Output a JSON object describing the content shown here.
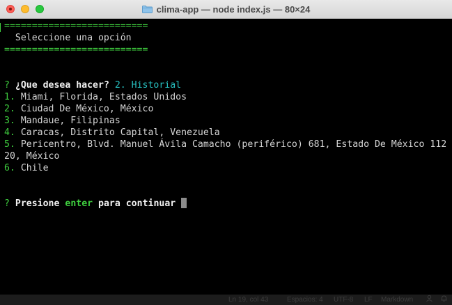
{
  "window": {
    "title": "clima-app — node index.js — 80×24"
  },
  "terminal": {
    "separator": "==========================",
    "header": "  Seleccione una opción",
    "prompt": {
      "mark": "?",
      "question": "¿Que desea hacer?",
      "answer": "2. Historial"
    },
    "history": [
      {
        "num": "1.",
        "text": "Miami, Florida, Estados Unidos"
      },
      {
        "num": "2.",
        "text": "Ciudad De México, México"
      },
      {
        "num": "3.",
        "text": "Mandaue, Filipinas"
      },
      {
        "num": "4.",
        "text": "Caracas, Distrito Capital, Venezuela"
      },
      {
        "num": "5.",
        "text": "Pericentro, Blvd. Manuel Ávila Camacho (periférico) 681, Estado De México 112"
      },
      {
        "num": "6.",
        "text": "Chile"
      }
    ],
    "history_wrap": "20, México",
    "continue": {
      "mark": "?",
      "before": "Presione",
      "key": "enter",
      "after": "para continuar"
    }
  },
  "statusbar": {
    "position": "Ln 19, col 43",
    "spaces": "Espacios: 4",
    "encoding": "UTF-8",
    "eol": "LF",
    "language": "Markdown"
  },
  "colors": {
    "green": "#3fcf3f",
    "cyan": "#27c0c0",
    "background": "#000000"
  }
}
